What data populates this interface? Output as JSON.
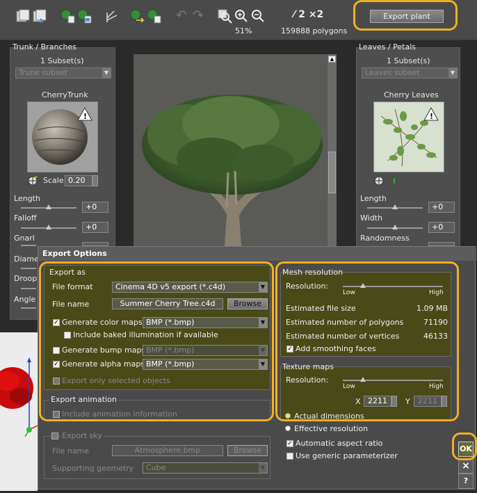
{
  "toolbar": {
    "zoom_percent": "51%",
    "polygon_count": "159888 polygons",
    "lod_label": "⁄ 2 ×2",
    "export_plant_label": "Export plant"
  },
  "trunk_panel": {
    "title": "Trunk / Branches",
    "subset_count": "1 Subset(s)",
    "subset_placeholder": "Trunk subset",
    "material_name": "CherryTrunk",
    "scale_label": "Scale",
    "scale_value": "0.20",
    "sliders": [
      {
        "label": "Length",
        "value": "+0",
        "level": 0.5
      },
      {
        "label": "Falloff",
        "value": "+0",
        "level": 0.5
      },
      {
        "label": "Gnarl",
        "value": "",
        "level": 0.5
      },
      {
        "label": "Diameter",
        "value": "",
        "level": 0.5
      },
      {
        "label": "Droop",
        "value": "",
        "level": 0.5
      },
      {
        "label": "Angle",
        "value": "",
        "level": 0.5
      }
    ]
  },
  "leaves_panel": {
    "title": "Leaves / Petals",
    "subset_count": "1 Subset(s)",
    "subset_placeholder": "Leaves subset",
    "material_name": "Cherry Leaves",
    "sliders": [
      {
        "label": "Length",
        "value": "+0",
        "level": 0.5
      },
      {
        "label": "Width",
        "value": "+0",
        "level": 0.5
      },
      {
        "label": "Randomness",
        "value": "",
        "level": 0.5
      }
    ]
  },
  "dialog": {
    "title": "Export Options",
    "export_as": {
      "title": "Export as",
      "file_format_label": "File format",
      "file_format_value": "Cinema 4D v5 export (*.c4d)",
      "file_name_label": "File name",
      "file_name_value": "Summer Cherry Tree.c4d",
      "browse_label": "Browse",
      "color_maps_label": "Generate color maps",
      "color_maps_checked": true,
      "color_maps_format": "BMP (*.bmp)",
      "baked_label": "Include baked illumination if available",
      "baked_checked": false,
      "bump_maps_label": "Generate bump maps",
      "bump_maps_checked": false,
      "bump_maps_format": "BMP (*.bmp)",
      "alpha_maps_label": "Generate alpha maps",
      "alpha_maps_checked": true,
      "alpha_maps_format": "BMP (*.bmp)",
      "selected_only_label": "Export only selected objects"
    },
    "export_animation": {
      "title": "Export animation",
      "include_anim_label": "Include animation information"
    },
    "export_sky": {
      "title": "Export sky",
      "file_name_label": "File name",
      "file_name_value": "Atmosphere.bmp",
      "browse_label": "Browse",
      "geometry_label": "Supporting geometry",
      "geometry_value": "Cube"
    },
    "mesh_resolution": {
      "title": "Mesh resolution",
      "resolution_label": "Resolution:",
      "low_label": "Low",
      "high_label": "High",
      "level": 0.2,
      "file_size_label": "Estimated file size",
      "file_size_value": "1.09 MB",
      "polygons_label": "Estimated number of polygons",
      "polygons_value": "71190",
      "vertices_label": "Estimated number of vertices",
      "vertices_value": "46133",
      "smoothing_label": "Add smoothing faces",
      "smoothing_checked": true
    },
    "texture_maps": {
      "title": "Texture maps",
      "resolution_label": "Resolution:",
      "low_label": "Low",
      "high_label": "High",
      "level": 0.2,
      "x_label": "X",
      "x_value": "2211",
      "y_label": "Y",
      "y_value": "2211",
      "actual_dimensions_label": "Actual dimensions",
      "effective_resolution_label": "Effective resolution",
      "aspect_label": "Automatic aspect ratio",
      "aspect_checked": true,
      "generic_param_label": "Use generic parameterizer",
      "generic_param_checked": false
    },
    "ok_label": "OK",
    "close_label": "×",
    "help_label": "?"
  },
  "colors": {
    "highlight": "#f0b020",
    "olive_group": "#4a4a18"
  }
}
